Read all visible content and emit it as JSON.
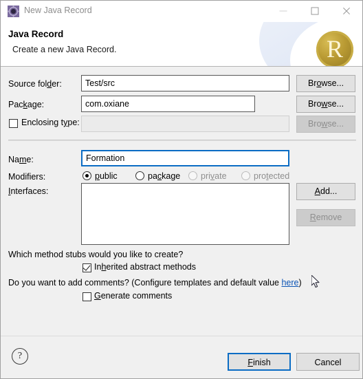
{
  "window": {
    "title": "New Java Record",
    "icon": "eclipse-wizard-icon",
    "minimize_label": "–",
    "maximize_label": "□",
    "close_label": "✕"
  },
  "header": {
    "title": "Java Record",
    "description": "Create a new Java Record.",
    "logo_letter": "R"
  },
  "form": {
    "source_folder": {
      "label_pre": "Source fol",
      "label_mnemonic": "d",
      "label_post": "er:",
      "value": "Test/src",
      "browse": {
        "pre": "Br",
        "mnemonic": "o",
        "post": "wse..."
      }
    },
    "package": {
      "label_pre": "Pac",
      "label_mnemonic": "k",
      "label_post": "age:",
      "value": "com.oxiane",
      "browse": {
        "pre": "Bro",
        "mnemonic": "w",
        "post": "se..."
      }
    },
    "enclosing_type": {
      "label_pre": "Enclosing t",
      "label_mnemonic": "y",
      "label_post": "pe:",
      "checked": false,
      "value": "",
      "enabled": false,
      "browse": {
        "pre": "Bro",
        "mnemonic": "w",
        "post": "se..."
      }
    },
    "name": {
      "label_pre": "Na",
      "label_mnemonic": "m",
      "label_post": "e:",
      "value": "Formation",
      "focused": true
    },
    "modifiers": {
      "label": "Modifiers:",
      "options": [
        {
          "pre": "",
          "mnemonic": "p",
          "post": "ublic",
          "selected": true,
          "enabled": true
        },
        {
          "pre": "pa",
          "mnemonic": "c",
          "post": "kage",
          "selected": false,
          "enabled": true
        },
        {
          "pre": "pri",
          "mnemonic": "v",
          "post": "ate",
          "selected": false,
          "enabled": false
        },
        {
          "pre": "pro",
          "mnemonic": "t",
          "post": "ected",
          "selected": false,
          "enabled": false
        }
      ]
    },
    "interfaces": {
      "label_pre": "",
      "label_mnemonic": "I",
      "label_post": "nterfaces:",
      "items": [],
      "add_button": {
        "pre": "",
        "mnemonic": "A",
        "post": "dd..."
      },
      "remove_button": {
        "pre": "",
        "mnemonic": "R",
        "post": "emove"
      }
    },
    "stubs_question": "Which method stubs would you like to create?",
    "inherited_abstract": {
      "label_pre": "In",
      "label_mnemonic": "h",
      "label_post": "erited abstract methods",
      "checked": true
    },
    "comments_question_pre": "Do you want to add comments? (Configure templates and default value ",
    "comments_link": "here",
    "comments_question_post": ")",
    "generate_comments": {
      "label_pre": "",
      "label_mnemonic": "G",
      "label_post": "enerate comments",
      "checked": false
    }
  },
  "footer": {
    "help_label": "?",
    "finish": {
      "pre": "",
      "mnemonic": "F",
      "post": "inish"
    },
    "cancel": "Cancel"
  }
}
